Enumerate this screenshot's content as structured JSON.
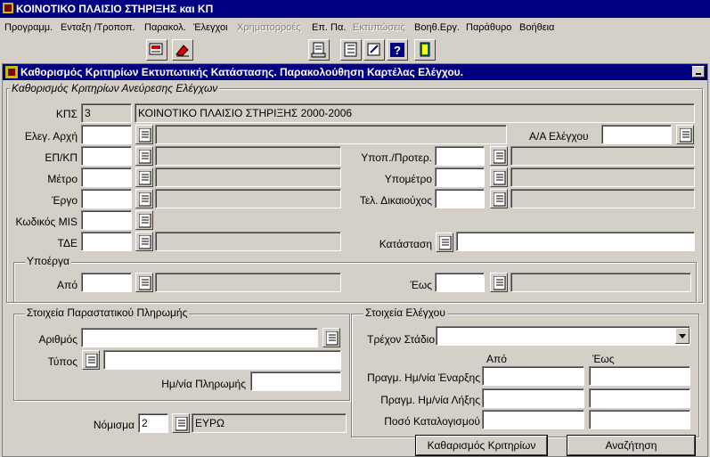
{
  "app": {
    "title": "ΚΟΙΝΟΤΙΚΟ ΠΛΑΙΣΙΟ ΣΤΗΡΙΞΗΣ και ΚΠ"
  },
  "menu": [
    {
      "label": "Προγραμμ.",
      "enabled": true
    },
    {
      "label": "Ενταξη /Τροποπ.",
      "enabled": true
    },
    {
      "label": "Παρακολ.",
      "enabled": true
    },
    {
      "label": "Έλεγχοι",
      "enabled": true
    },
    {
      "label": "Χρηματορροές",
      "enabled": false
    },
    {
      "label": "Επ. Πα.",
      "enabled": true
    },
    {
      "label": "Εκτυπώσεις",
      "enabled": false
    },
    {
      "label": "Βοηθ.Εργ.",
      "enabled": true
    },
    {
      "label": "Παράθυρο",
      "enabled": true
    },
    {
      "label": "Βοήθεια",
      "enabled": true
    }
  ],
  "window": {
    "title": "Καθορισμός Κριτηρίων Εκτυπωτικής Κατάστασης. Παρακολούθηση Καρτέλας Ελέγχου."
  },
  "criteria": {
    "group_title": "Καθορισμός Κριτηρίων Ανεύρεσης Ελέγχων",
    "kps_label": "ΚΠΣ",
    "kps_code": "3",
    "kps_desc": "ΚΟΙΝΟΤΙΚΟ ΠΛΑΙΣΙΟ ΣΤΗΡΙΞΗΣ 2000-2006",
    "elegx_arxi_label": "Ελεγ. Αρχή",
    "aa_elegxou_label": "Α/Α Ελέγχου",
    "ep_kp_label": "ΕΠ/ΚΠ",
    "ypop_label": "Υποπ./Προτερ.",
    "metro_label": "Μέτρο",
    "ypometro_label": "Υπομέτρο",
    "ergo_label": "Έργο",
    "tel_dikaiouxos_label": "Τελ. Δικαιούχος",
    "kodikos_mis_label": "Κωδικός MIS",
    "tde_label": "ΤΔΕ",
    "katastasi_label": "Κατάσταση"
  },
  "ypoerga": {
    "title": "Υποέργα",
    "apo_label": "Από",
    "eos_label": "Έως"
  },
  "payment": {
    "title": "Στοιχεία Παραστατικού Πληρωμής",
    "arithmos_label": "Αριθμός",
    "typos_label": "Τύπος",
    "date_label": "Ημ/νία Πληρωμής"
  },
  "control": {
    "title": "Στοιχεία Ελέγχου",
    "stage_label": "Τρέχον Στάδιο",
    "apo_header": "Από",
    "eos_header": "Έως",
    "start_label": "Πραγμ. Ημ/νία Έναρξης",
    "end_label": "Πραγμ. Ημ/νία Λήξης",
    "amount_label": "Ποσό Καταλογισμού"
  },
  "currency": {
    "label": "Νόμισμα",
    "code": "2",
    "name": "ΕΥΡΩ"
  },
  "buttons": {
    "clear": "Καθαρισμός Κριτηρίων",
    "search": "Αναζήτηση"
  }
}
